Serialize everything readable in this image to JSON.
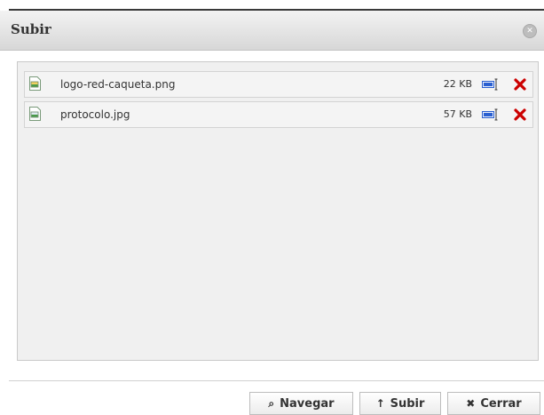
{
  "dialog": {
    "title": "Subir",
    "close_symbol": "✕"
  },
  "files": [
    {
      "name": "logo-red-caqueta.png",
      "size": "22 KB",
      "icon": "image-file-icon",
      "actions": [
        "rename-icon",
        "delete-icon"
      ]
    },
    {
      "name": "protocolo.jpg",
      "size": "57 KB",
      "icon": "image-file-icon",
      "actions": [
        "rename-icon",
        "delete-icon"
      ]
    }
  ],
  "buttons": {
    "navegar": {
      "icon": "⌕",
      "label": "Navegar"
    },
    "subir": {
      "icon": "↑",
      "label": "Subir"
    },
    "cerrar": {
      "icon": "✖",
      "label": "Cerrar"
    }
  },
  "colors": {
    "delete": "#cc0000",
    "rename": "#2a5fd0"
  }
}
